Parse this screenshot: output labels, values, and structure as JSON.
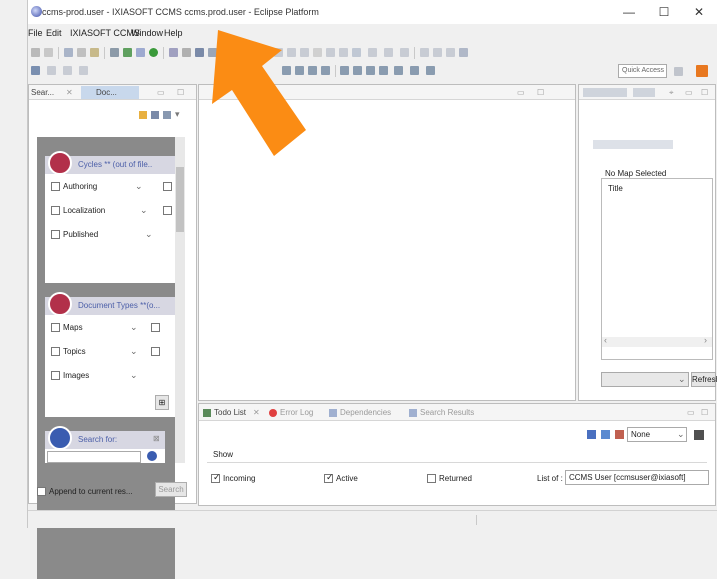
{
  "window": {
    "title": "ccms-prod.user - IXIASOFT CCMS ccms.prod.user - Eclipse Platform",
    "minimize": "—",
    "maximize": "☐",
    "close": "✕"
  },
  "menu": {
    "items": [
      "File",
      "Edit",
      "IXIASOFT CCMS",
      "Window",
      "Help"
    ]
  },
  "toolbar": {
    "quick_access": "Quick Access"
  },
  "left_panel": {
    "tab_search": "Sear...",
    "tab_doc": "Doc...",
    "cycles": {
      "title": "Cycles ** (out of file..",
      "items": [
        "Authoring",
        "Localization",
        "Published"
      ]
    },
    "doc_types": {
      "title": "Document Types **(o...",
      "items": [
        "Maps",
        "Topics",
        "Images"
      ]
    },
    "search_for": "Search for:",
    "append_label": "Append to current res...",
    "search_button": "Search"
  },
  "right_panel": {
    "no_map": "No Map Selected",
    "title_col": "Title",
    "refresh": "Refresh"
  },
  "bottom_panel": {
    "tabs": {
      "todo": "Todo List",
      "error_log": "Error Log",
      "dependencies": "Dependencies",
      "search_results": "Search Results"
    },
    "select_none": "None",
    "show_label": "Show",
    "incoming": "Incoming",
    "active": "Active",
    "returned": "Returned",
    "list_of_label": "List of :",
    "list_of_value": "CCMS User [ccmsuser@ixiasoft]"
  },
  "colors": {
    "arrow": "#fb8c14",
    "card_bg": "#8a8a8a",
    "card_head": "#d7d7e2",
    "cycle_icon": "#b2304a",
    "search_icon": "#3a5cb0"
  }
}
